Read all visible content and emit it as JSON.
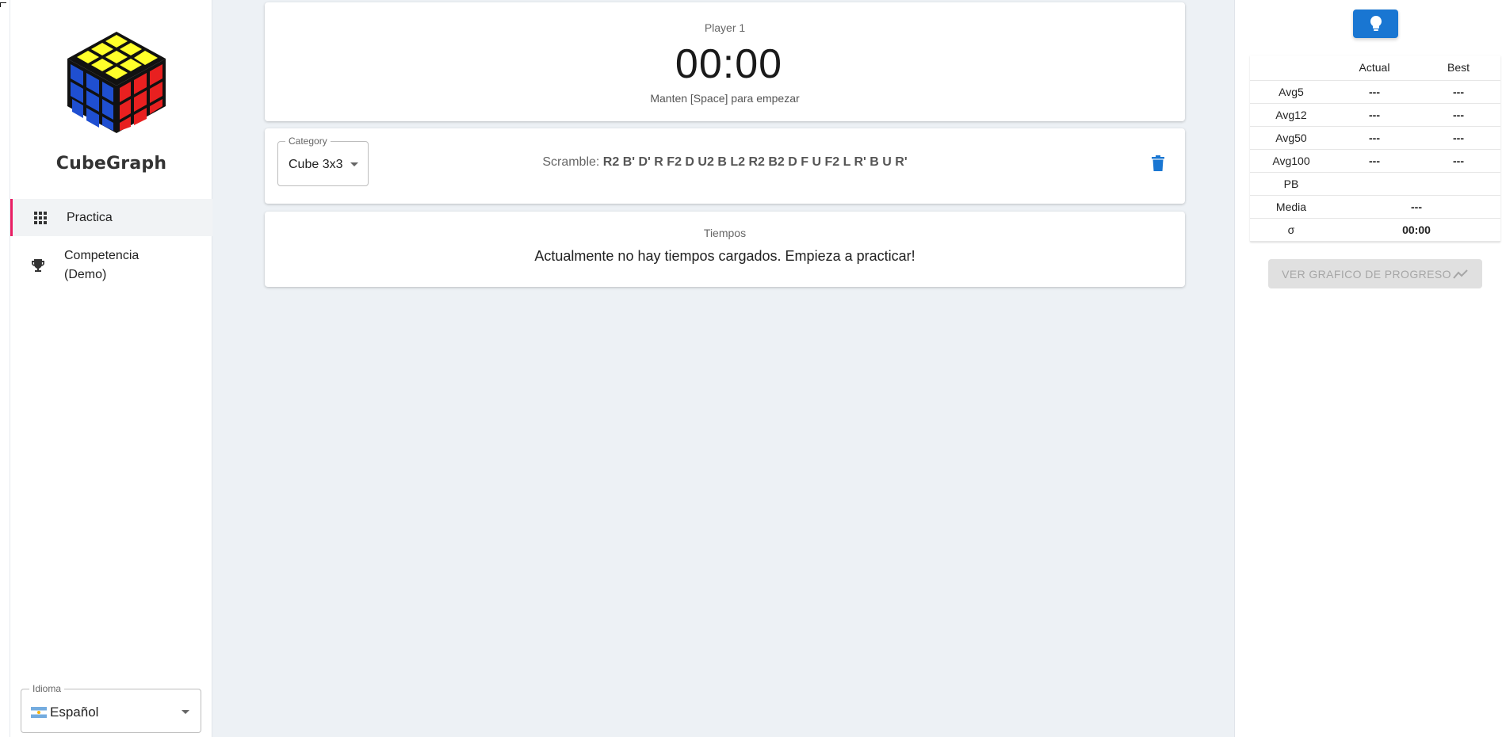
{
  "app": {
    "brand": "CubeGraph"
  },
  "sidebar": {
    "items": [
      {
        "label": "Practica",
        "icon": "grid-icon"
      },
      {
        "label": "Competencia (Demo)",
        "icon": "trophy-icon"
      }
    ],
    "language": {
      "legend": "Idioma",
      "value": "Español",
      "icon": "argentina-flag-icon"
    }
  },
  "timer": {
    "player": "Player 1",
    "time": "00:00",
    "hint": "Manten [Space] para empezar"
  },
  "scramble": {
    "category_legend": "Category",
    "category_value": "Cube 3x3",
    "label": "Scramble:",
    "moves": "R2 B' D' R F2 D U2 B L2 R2 B2 D F U F2 L R' B U R'"
  },
  "times": {
    "title": "Tiempos",
    "empty_message": "Actualmente no hay tiempos cargados. Empieza a practicar!"
  },
  "stats": {
    "headers": [
      "",
      "Actual",
      "Best"
    ],
    "rows": [
      {
        "label": "Avg5",
        "actual": "---",
        "best": "---"
      },
      {
        "label": "Avg12",
        "actual": "---",
        "best": "---"
      },
      {
        "label": "Avg50",
        "actual": "---",
        "best": "---"
      },
      {
        "label": "Avg100",
        "actual": "---",
        "best": "---"
      }
    ],
    "pb": {
      "label": "PB",
      "value": ""
    },
    "media": {
      "label": "Media",
      "value": "---"
    },
    "sigma": {
      "label": "σ",
      "value": "00:00"
    }
  },
  "progress_button": {
    "label": "VER GRAFICO DE PROGRESO"
  },
  "colors": {
    "accent": "#1976d2",
    "active_indicator": "#e91e63",
    "background": "#edf1f5"
  }
}
